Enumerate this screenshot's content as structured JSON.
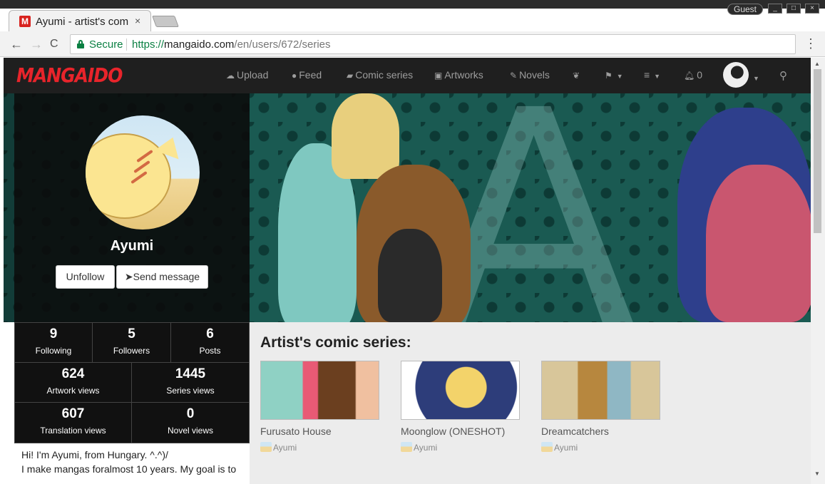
{
  "browser": {
    "tab_title": "Ayumi - artist's com",
    "tab_favicon_letter": "M",
    "tab_close": "×",
    "guest_label": "Guest",
    "secure_label": "Secure",
    "url_scheme": "https://",
    "url_host": "mangaido.com",
    "url_path": "/en/users/672/series",
    "back_glyph": "←",
    "forward_glyph": "→",
    "reload_glyph": "C",
    "menu_glyph": "⋮"
  },
  "site": {
    "logo": "MANGAIDO",
    "nav": {
      "upload": "Upload",
      "feed": "Feed",
      "comic_series": "Comic series",
      "artworks": "Artworks",
      "novels": "Novels",
      "notifications": "0"
    }
  },
  "profile": {
    "name": "Ayumi",
    "unfollow_label": "Unfollow",
    "send_message_label": "Send message",
    "stats": [
      {
        "value": "9",
        "label": "Following"
      },
      {
        "value": "5",
        "label": "Followers"
      },
      {
        "value": "6",
        "label": "Posts"
      },
      {
        "value": "624",
        "label": "Artwork views"
      },
      {
        "value": "1445",
        "label": "Series views"
      },
      {
        "value": "607",
        "label": "Translation views"
      },
      {
        "value": "0",
        "label": "Novel views"
      }
    ],
    "bio_line1": "Hi! I'm Ayumi, from Hungary. ^.^)/",
    "bio_line2": "I make mangas foralmost 10 years. My goal is to"
  },
  "main": {
    "section_title": "Artist's comic series:",
    "series": [
      {
        "title": "Furusato House",
        "author": "Ayumi"
      },
      {
        "title": "Moonglow (ONESHOT)",
        "author": "Ayumi"
      },
      {
        "title": "Dreamcatchers",
        "author": "Ayumi"
      }
    ]
  },
  "colors": {
    "brand_red": "#e8242b",
    "navbar_bg": "#1f1f1f",
    "secure_green": "#0b8043"
  }
}
